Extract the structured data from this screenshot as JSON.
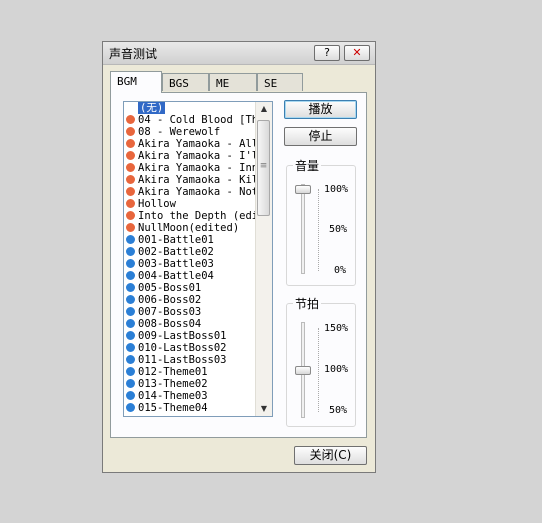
{
  "window": {
    "title": "声音测试",
    "help_label": "?",
    "close_label": "✕"
  },
  "tabs": [
    {
      "label": "BGM",
      "active": true
    },
    {
      "label": "BGS",
      "active": false
    },
    {
      "label": "ME",
      "active": false
    },
    {
      "label": "SE",
      "active": false
    }
  ],
  "list": {
    "selected_index": 0,
    "items": [
      {
        "label": "(无)",
        "color": "#3169c6"
      },
      {
        "label": "04 - Cold Blood [Th",
        "color": "#e8663d"
      },
      {
        "label": "08 - Werewolf",
        "color": "#e8663d"
      },
      {
        "label": "Akira Yamaoka - All",
        "color": "#e8663d"
      },
      {
        "label": "Akira Yamaoka - I'l",
        "color": "#e8663d"
      },
      {
        "label": "Akira Yamaoka - Inn",
        "color": "#e8663d"
      },
      {
        "label": "Akira Yamaoka - Kil",
        "color": "#e8663d"
      },
      {
        "label": "Akira Yamaoka - Not",
        "color": "#e8663d"
      },
      {
        "label": "Hollow",
        "color": "#e8663d"
      },
      {
        "label": "Into the Depth (edi",
        "color": "#e8663d"
      },
      {
        "label": "NullMoon(edited)",
        "color": "#e8663d"
      },
      {
        "label": "001-Battle01",
        "color": "#2b7fd6"
      },
      {
        "label": "002-Battle02",
        "color": "#2b7fd6"
      },
      {
        "label": "003-Battle03",
        "color": "#2b7fd6"
      },
      {
        "label": "004-Battle04",
        "color": "#2b7fd6"
      },
      {
        "label": "005-Boss01",
        "color": "#2b7fd6"
      },
      {
        "label": "006-Boss02",
        "color": "#2b7fd6"
      },
      {
        "label": "007-Boss03",
        "color": "#2b7fd6"
      },
      {
        "label": "008-Boss04",
        "color": "#2b7fd6"
      },
      {
        "label": "009-LastBoss01",
        "color": "#2b7fd6"
      },
      {
        "label": "010-LastBoss02",
        "color": "#2b7fd6"
      },
      {
        "label": "011-LastBoss03",
        "color": "#2b7fd6"
      },
      {
        "label": "012-Theme01",
        "color": "#2b7fd6"
      },
      {
        "label": "013-Theme02",
        "color": "#2b7fd6"
      },
      {
        "label": "014-Theme03",
        "color": "#2b7fd6"
      },
      {
        "label": "015-Theme04",
        "color": "#2b7fd6"
      }
    ]
  },
  "buttons": {
    "play_label": "播放",
    "stop_label": "停止",
    "close_label": "关闭(C)"
  },
  "volume": {
    "label": "音量",
    "value_percent": 100,
    "tick_labels": [
      "100%",
      "50%",
      "0%"
    ]
  },
  "pitch": {
    "label": "节拍",
    "value_percent": 100,
    "tick_labels": [
      "150%",
      "100%",
      "50%"
    ]
  },
  "icons": {
    "scroll_up": "scroll-up-icon",
    "scroll_down": "scroll-down-icon",
    "grip": "grip-icon"
  }
}
